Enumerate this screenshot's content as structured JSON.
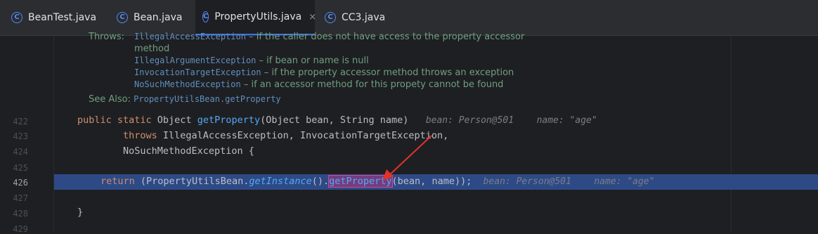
{
  "tabs": [
    {
      "label": "BeanTest.java",
      "icon": "class-icon",
      "active": false
    },
    {
      "label": "Bean.java",
      "icon": "class-icon",
      "active": false
    },
    {
      "label": "PropertyUtils.java",
      "icon": "class-icon",
      "active": true,
      "close": "×"
    },
    {
      "label": "CC3.java",
      "icon": "class-icon",
      "active": false
    }
  ],
  "tab_icon_glyph": "C",
  "javadoc": {
    "throws_label": "Throws:",
    "throws": [
      {
        "exception": "IllegalAccessException",
        "text": " – if the caller does not have access to the property accessor"
      },
      {
        "exception": "",
        "text": "method"
      },
      {
        "exception": "IllegalArgumentException",
        "text": " – if bean or name is null"
      },
      {
        "exception": "InvocationTargetException",
        "text": " – if the property accessor method throws an exception"
      },
      {
        "exception": "NoSuchMethodException",
        "text": " – if an accessor method for this propety cannot be found"
      }
    ],
    "see_also_label": "See Also:",
    "see_also_link": "PropertyUtilsBean.getProperty"
  },
  "line_numbers": [
    "422",
    "423",
    "424",
    "425",
    "426",
    "427",
    "428",
    "429"
  ],
  "code": {
    "l422": {
      "kw": "public static",
      "text1": " Object ",
      "fn": "getProperty",
      "text2": "(Object bean, String name)",
      "hint1": "bean: Person@501",
      "hint2": "name: \"age\""
    },
    "l423": {
      "kw": "throws",
      "text": " IllegalAccessException, InvocationTargetException,"
    },
    "l424": {
      "text": "NoSuchMethodException {"
    },
    "l426": {
      "kw": "return",
      "text1": " (PropertyUtilsBean.",
      "fn_italic": "getInstance",
      "text2": "().",
      "fn_selected": "getProperty",
      "text3": "(bean, name));",
      "hint1": "bean: Person@501",
      "hint2": "name: \"age\""
    },
    "l428": {
      "text": "}"
    }
  },
  "colors": {
    "execution_line": "#2d4a87",
    "selection": "#743d80",
    "arrow": "#e0322c"
  }
}
